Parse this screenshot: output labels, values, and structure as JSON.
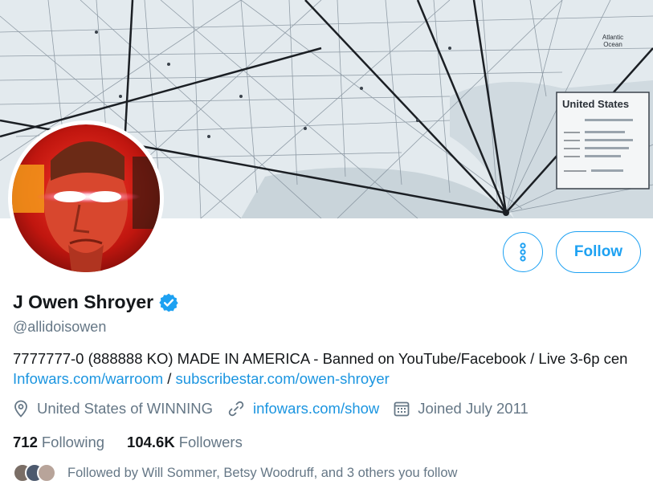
{
  "profile": {
    "display_name": "J Owen Shroyer",
    "handle": "@allidoisowen",
    "bio_text": "7777777-0 (888888 KO) MADE IN AMERICA - Banned on YouTube/Facebook / Live 3-6p cen",
    "bio_link_1": "Infowars.com/warroom",
    "bio_separator": "/",
    "bio_link_2": "subscribestar.com/owen-shroyer",
    "location": "United States of WINNING",
    "website": "infowars.com/show",
    "joined": "Joined July 2011",
    "following_count": "712",
    "following_label": "Following",
    "followers_count": "104.6K",
    "followers_label": "Followers",
    "followed_by": "Followed by Will Sommer, Betsy Woodruff, and 3 others you follow"
  },
  "actions": {
    "follow_label": "Follow"
  },
  "banner": {
    "map_legend_title": "United States",
    "map_ocean_label": "Atlantic Ocean"
  },
  "colors": {
    "accent": "#1da1f2",
    "link": "#1b95e0",
    "secondary_text": "#657786"
  },
  "icons": {
    "more": "more-vertical-icon",
    "verified": "verified-badge-icon",
    "location": "location-pin-icon",
    "website": "link-icon",
    "joined": "calendar-icon"
  }
}
